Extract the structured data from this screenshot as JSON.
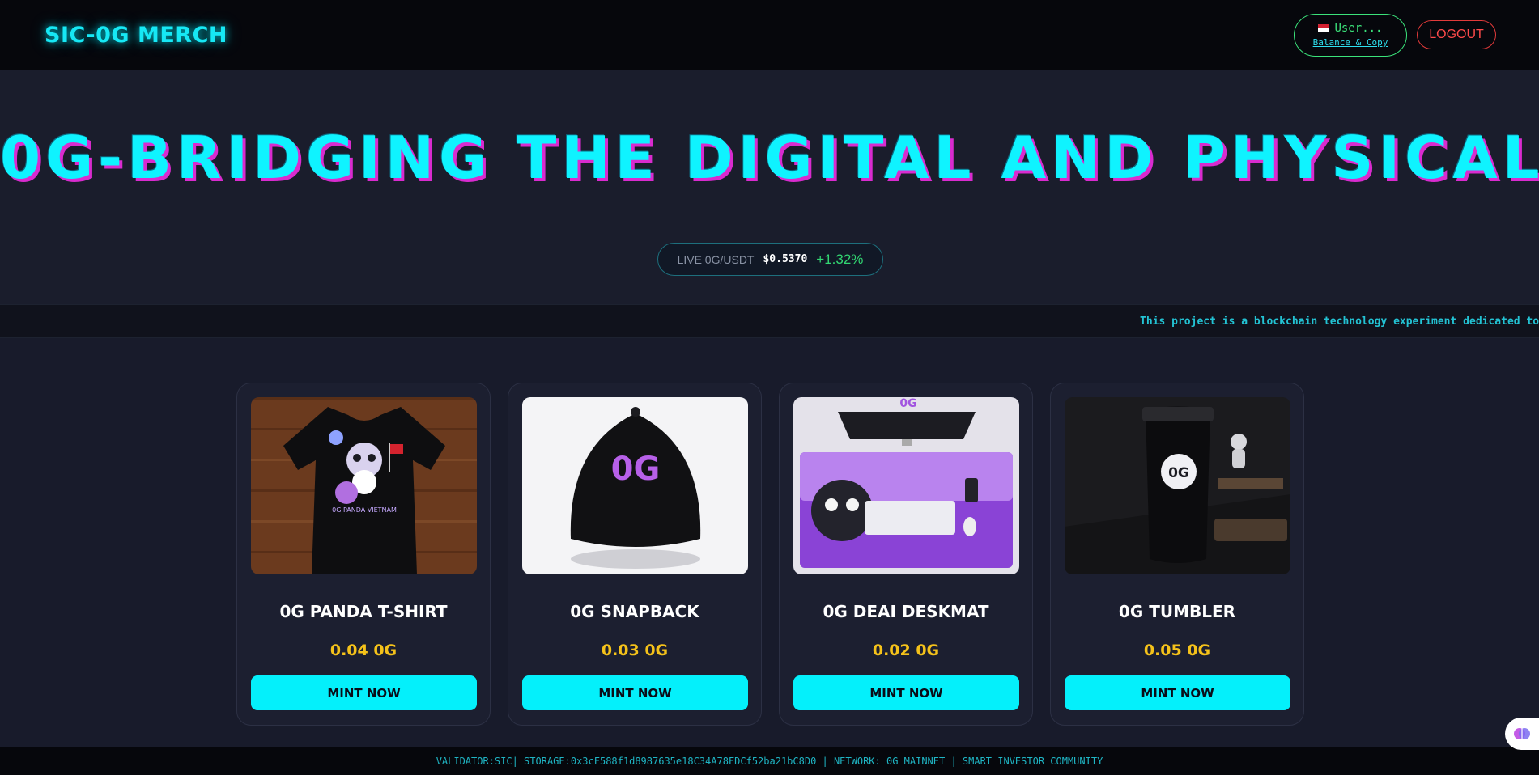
{
  "nav": {
    "brand": "SIC-0G MERCH",
    "wallet_user": "User...",
    "wallet_link": "Balance & Copy",
    "logout_label": "LOGOUT"
  },
  "hero": {
    "title": "0G-BRIDGING THE DIGITAL AND PHYSICAL",
    "price_label": "LIVE 0G/USDT",
    "price_value": "$0.5370",
    "price_change": "+1.32%"
  },
  "ticker": {
    "text": "This project is a blockchain technology experiment dedicated to"
  },
  "products": [
    {
      "name": "0G PANDA T-SHIRT",
      "price": "0.04 0G",
      "button": "MINT NOW",
      "image_label": "0G PANDA VIETNAM"
    },
    {
      "name": "0G SNAPBACK",
      "price": "0.03 0G",
      "button": "MINT NOW",
      "image_label": "0G"
    },
    {
      "name": "0G DEAI DESKMAT",
      "price": "0.02 0G",
      "button": "MINT NOW",
      "image_label": "0G"
    },
    {
      "name": "0G TUMBLER",
      "price": "0.05 0G",
      "button": "MINT NOW",
      "image_label": "0G"
    }
  ],
  "footer": {
    "text": "VALIDATOR:SIC| STORAGE:0x3cF588f1d8987635e18C34A78FDCf52ba21bC8D0 | NETWORK: 0G MAINNET | SMART INVESTOR COMMUNITY"
  },
  "colors": {
    "accent": "#04f0fb",
    "price": "#f5c21a",
    "wallet_green": "#3be27a",
    "logout_red": "#e23a3a",
    "title_shadow": "#d92bcf"
  }
}
